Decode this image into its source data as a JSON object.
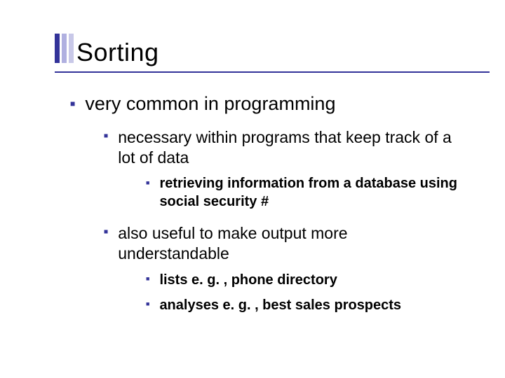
{
  "title": "Sorting",
  "bullets": {
    "l1": "very common in programming",
    "l2a": "necessary within programs that keep track of a lot of data",
    "l3a": "retrieving information from a database using social security #",
    "l2b": "also useful to make output more understandable",
    "l3b": "lists e. g. , phone directory",
    "l3c": "analyses e. g. , best sales prospects"
  }
}
